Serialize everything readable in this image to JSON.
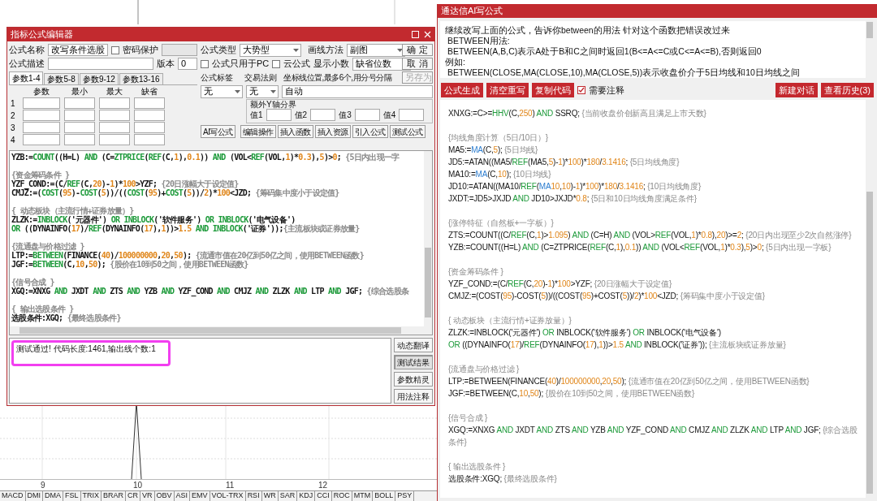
{
  "left_dialog": {
    "title": "指标公式编辑器",
    "name_field": {
      "label": "公式名称",
      "value": "改写条件选股"
    },
    "password": {
      "label": "密码保护",
      "checked": false
    },
    "desc_field": {
      "label": "公式描述"
    },
    "version": {
      "label": "版本",
      "value": "0"
    },
    "formula_type": {
      "label": "公式类型",
      "value": "大势型"
    },
    "draw_method": {
      "label": "画线方法",
      "value": "副图"
    },
    "pc_only": {
      "label": "公式只用于PC",
      "checked": false
    },
    "cloud": {
      "label": "云公式",
      "checked": false
    },
    "decimals": {
      "label": "显示小数",
      "value": "缺省位数"
    },
    "dialog_buttons": [
      {
        "label": "确 定",
        "disabled": false
      },
      {
        "label": "取 消",
        "disabled": false
      },
      {
        "label": "另存为",
        "disabled": true
      }
    ],
    "param_tabs": [
      {
        "label": "参数1-4",
        "selected": true
      },
      {
        "label": "参数5-8",
        "selected": false
      },
      {
        "label": "参数9-12",
        "selected": false
      },
      {
        "label": "参数13-16",
        "selected": false
      }
    ],
    "param_columns": [
      "参数",
      "最小",
      "最大",
      "缺省"
    ],
    "param_rows": [
      "1",
      "2",
      "3",
      "4"
    ],
    "tag": {
      "label": "公式标签",
      "value": "无"
    },
    "trade_rule": {
      "label": "交易法则",
      "value": "无"
    },
    "axis_lines": {
      "label": "坐标线位置,最多6个,用分号分隔",
      "value": "自动"
    },
    "y_bounds": {
      "title": "额外Y轴分界",
      "labels": [
        "值1",
        "值2",
        "值3",
        "值4"
      ]
    },
    "action_buttons": [
      "AI写公式",
      "编辑操作",
      "插入函数",
      "插入资源",
      "引入公式",
      "测试公式"
    ],
    "editor": {
      "blocks": [
        [
          [
            {
              "kind": "t",
              "text": "YZB:="
            },
            {
              "kind": "f",
              "text": "COUNT"
            },
            {
              "kind": "t",
              "text": "((H=L) "
            },
            {
              "kind": "k",
              "text": "AND"
            },
            {
              "kind": "t",
              "text": " (C="
            },
            {
              "kind": "f",
              "text": "ZTPRICE"
            },
            {
              "kind": "t",
              "text": "("
            },
            {
              "kind": "f",
              "text": "REF"
            },
            {
              "kind": "t",
              "text": "(C,"
            },
            {
              "kind": "n",
              "text": "1"
            },
            {
              "kind": "t",
              "text": "),"
            },
            {
              "kind": "n",
              "text": "0.1"
            },
            {
              "kind": "t",
              "text": ")) "
            },
            {
              "kind": "k",
              "text": "AND"
            },
            {
              "kind": "t",
              "text": " (VOL<"
            },
            {
              "kind": "f",
              "text": "REF"
            },
            {
              "kind": "t",
              "text": "(VOL,"
            },
            {
              "kind": "n",
              "text": "1"
            },
            {
              "kind": "t",
              "text": ")*"
            },
            {
              "kind": "n",
              "text": "0.3"
            },
            {
              "kind": "t",
              "text": "),"
            },
            {
              "kind": "n",
              "text": "5"
            },
            {
              "kind": "t",
              "text": ")>"
            },
            {
              "kind": "n",
              "text": "0"
            },
            {
              "kind": "t",
              "text": "; "
            },
            {
              "kind": "c",
              "text": "{5日内出现一字"
            }
          ]
        ],
        [
          [
            {
              "kind": "c",
              "text": "{资金筹码条件 }"
            }
          ],
          [
            {
              "kind": "t",
              "text": "YZF_COND:=(C/"
            },
            {
              "kind": "f",
              "text": "REF"
            },
            {
              "kind": "t",
              "text": "(C,"
            },
            {
              "kind": "n",
              "text": "20"
            },
            {
              "kind": "t",
              "text": ")-"
            },
            {
              "kind": "n",
              "text": "1"
            },
            {
              "kind": "t",
              "text": ")*"
            },
            {
              "kind": "n",
              "text": "100"
            },
            {
              "kind": "t",
              "text": ">YZF; "
            },
            {
              "kind": "c",
              "text": "{20日涨幅大于设定值}"
            }
          ],
          [
            {
              "kind": "t",
              "text": "CMJZ:=("
            },
            {
              "kind": "f",
              "text": "COST"
            },
            {
              "kind": "t",
              "text": "("
            },
            {
              "kind": "n",
              "text": "95"
            },
            {
              "kind": "t",
              "text": ")-"
            },
            {
              "kind": "f",
              "text": "COST"
            },
            {
              "kind": "t",
              "text": "("
            },
            {
              "kind": "n",
              "text": "5"
            },
            {
              "kind": "t",
              "text": "))/(("
            },
            {
              "kind": "f",
              "text": "COST"
            },
            {
              "kind": "t",
              "text": "("
            },
            {
              "kind": "n",
              "text": "95"
            },
            {
              "kind": "t",
              "text": ")+"
            },
            {
              "kind": "f",
              "text": "COST"
            },
            {
              "kind": "t",
              "text": "("
            },
            {
              "kind": "n",
              "text": "5"
            },
            {
              "kind": "t",
              "text": "))/"
            },
            {
              "kind": "n",
              "text": "2"
            },
            {
              "kind": "t",
              "text": ")*"
            },
            {
              "kind": "n",
              "text": "100"
            },
            {
              "kind": "t",
              "text": "<JZD; "
            },
            {
              "kind": "c",
              "text": "{筹码集中度小于设定值}"
            }
          ]
        ],
        [
          [
            {
              "kind": "c",
              "text": "{ 动态板块（主流行情+证券放量）}"
            }
          ],
          [
            {
              "kind": "t",
              "text": "ZLZK:="
            },
            {
              "kind": "f",
              "text": "INBLOCK"
            },
            {
              "kind": "t",
              "text": "('元器件') "
            },
            {
              "kind": "k",
              "text": "OR "
            },
            {
              "kind": "f",
              "text": "INBLOCK"
            },
            {
              "kind": "t",
              "text": "('软件服务') "
            },
            {
              "kind": "k",
              "text": "OR "
            },
            {
              "kind": "f",
              "text": "INBLOCK"
            },
            {
              "kind": "t",
              "text": "('电气设备')"
            }
          ],
          [
            {
              "kind": "k",
              "text": "OR"
            },
            {
              "kind": "t",
              "text": " ((DYNAINFO("
            },
            {
              "kind": "n",
              "text": "17"
            },
            {
              "kind": "t",
              "text": ")/"
            },
            {
              "kind": "f",
              "text": "REF"
            },
            {
              "kind": "t",
              "text": "(DYNAINFO("
            },
            {
              "kind": "n",
              "text": "17"
            },
            {
              "kind": "t",
              "text": "),"
            },
            {
              "kind": "n",
              "text": "1"
            },
            {
              "kind": "t",
              "text": "))>"
            },
            {
              "kind": "n",
              "text": "1.5"
            },
            {
              "kind": "k",
              "text": " AND "
            },
            {
              "kind": "f",
              "text": "INBLOCK"
            },
            {
              "kind": "t",
              "text": "('证券'));"
            },
            {
              "kind": "c",
              "text": "{主流板块或证券放量}"
            }
          ]
        ],
        [
          [
            {
              "kind": "c",
              "text": "{流通盘与价格过滤 }"
            }
          ],
          [
            {
              "kind": "t",
              "text": "LTP:="
            },
            {
              "kind": "f",
              "text": "BETWEEN"
            },
            {
              "kind": "t",
              "text": "(FINANCE("
            },
            {
              "kind": "n",
              "text": "40"
            },
            {
              "kind": "t",
              "text": ")/"
            },
            {
              "kind": "n",
              "text": "100000000"
            },
            {
              "kind": "t",
              "text": ","
            },
            {
              "kind": "n",
              "text": "20"
            },
            {
              "kind": "t",
              "text": ","
            },
            {
              "kind": "n",
              "text": "50"
            },
            {
              "kind": "t",
              "text": "); "
            },
            {
              "kind": "c",
              "text": "{流通市值在20亿到50亿之间，使用BETWEEN函数}"
            }
          ],
          [
            {
              "kind": "t",
              "text": "JGF:="
            },
            {
              "kind": "f",
              "text": "BETWEEN"
            },
            {
              "kind": "t",
              "text": "(C,"
            },
            {
              "kind": "n",
              "text": "10"
            },
            {
              "kind": "t",
              "text": ","
            },
            {
              "kind": "n",
              "text": "50"
            },
            {
              "kind": "t",
              "text": "); "
            },
            {
              "kind": "c",
              "text": "{股价在10到50之间，使用BETWEEN函数}"
            }
          ]
        ],
        [
          [
            {
              "kind": "c",
              "text": "{信号合成 }"
            }
          ],
          [
            {
              "kind": "t",
              "text": "XGQ:=XNXG "
            },
            {
              "kind": "k",
              "text": "AND"
            },
            {
              "kind": "t",
              "text": " JXDT "
            },
            {
              "kind": "k",
              "text": "AND"
            },
            {
              "kind": "t",
              "text": " ZTS "
            },
            {
              "kind": "k",
              "text": "AND"
            },
            {
              "kind": "t",
              "text": " YZB "
            },
            {
              "kind": "k",
              "text": "AND"
            },
            {
              "kind": "t",
              "text": " YZF_COND "
            },
            {
              "kind": "k",
              "text": "AND"
            },
            {
              "kind": "t",
              "text": " CMJZ "
            },
            {
              "kind": "k",
              "text": "AND"
            },
            {
              "kind": "t",
              "text": " ZLZK "
            },
            {
              "kind": "k",
              "text": "AND"
            },
            {
              "kind": "t",
              "text": " LTP "
            },
            {
              "kind": "k",
              "text": "AND"
            },
            {
              "kind": "t",
              "text": " JGF; "
            },
            {
              "kind": "c",
              "text": "{综合选股条"
            }
          ]
        ],
        [
          [
            {
              "kind": "c",
              "text": "{ 输出选股条件 }"
            }
          ],
          [
            {
              "kind": "t",
              "text": "选股条件:XGQ; "
            },
            {
              "kind": "c",
              "text": "{最终选股条件}"
            }
          ]
        ]
      ]
    },
    "test_result": "测试通过! 代码长度:1461,输出线个数:1",
    "side_buttons": [
      {
        "label": "动态翻译",
        "selected": false
      },
      {
        "label": "测试结果",
        "selected": true
      },
      {
        "label": "参数精灵",
        "selected": false
      },
      {
        "label": "用法注释",
        "selected": false
      }
    ]
  },
  "right_window": {
    "title": "通达信AI写公式",
    "prompt_lines": [
      "继续改写上面的公式，告诉你between的用法 针对这个函数把错误改过来",
      " BETWEEN用法:",
      " BETWEEN(A,B,C)表示A处于B和C之间时返回1(B<=A<=C或C<=A<=B),否则返回0",
      "例如:",
      " BETWEEN(CLOSE,MA(CLOSE,10),MA(CLOSE,5))表示收盘价介于5日均线和10日均线之间"
    ],
    "left_buttons": [
      "公式生成",
      "清空重写",
      "复制代码"
    ],
    "annotate": {
      "label": "需要注释",
      "checked": true
    },
    "right_buttons": [
      "新建对话",
      "查看历史(3)"
    ],
    "code": {
      "blocks": [
        [
          [
            {
              "kind": "t",
              "text": "XNXG:=C>="
            },
            {
              "kind": "f",
              "text": "HHV"
            },
            {
              "kind": "t",
              "text": "(C,"
            },
            {
              "kind": "n",
              "text": "250"
            },
            {
              "kind": "t",
              "text": ") "
            },
            {
              "kind": "k",
              "text": "AND"
            },
            {
              "kind": "t",
              "text": " SSRQ; "
            },
            {
              "kind": "c",
              "text": "{当前收盘价创新高且满足上市天数}"
            }
          ]
        ],
        [
          [
            {
              "kind": "c",
              "text": "{均线角度计算（5日/10日）}"
            }
          ],
          [
            {
              "kind": "t",
              "text": "MA5:="
            },
            {
              "kind": "b",
              "text": "MA"
            },
            {
              "kind": "t",
              "text": "(C,"
            },
            {
              "kind": "n",
              "text": "5"
            },
            {
              "kind": "t",
              "text": "); "
            },
            {
              "kind": "c",
              "text": "{5日均线}"
            }
          ],
          [
            {
              "kind": "t",
              "text": "JD5:=ATAN((MA5/"
            },
            {
              "kind": "f",
              "text": "REF"
            },
            {
              "kind": "t",
              "text": "(MA5,"
            },
            {
              "kind": "n",
              "text": "5"
            },
            {
              "kind": "t",
              "text": ")-"
            },
            {
              "kind": "n",
              "text": "1"
            },
            {
              "kind": "t",
              "text": ")*"
            },
            {
              "kind": "n",
              "text": "100"
            },
            {
              "kind": "t",
              "text": ")*"
            },
            {
              "kind": "n",
              "text": "180"
            },
            {
              "kind": "t",
              "text": "/"
            },
            {
              "kind": "n",
              "text": "3.1416"
            },
            {
              "kind": "t",
              "text": "; "
            },
            {
              "kind": "c",
              "text": "{5日均线角度}"
            }
          ],
          [
            {
              "kind": "t",
              "text": "MA10:="
            },
            {
              "kind": "b",
              "text": "MA"
            },
            {
              "kind": "t",
              "text": "(C,"
            },
            {
              "kind": "n",
              "text": "10"
            },
            {
              "kind": "t",
              "text": "); "
            },
            {
              "kind": "c",
              "text": "{10日均线}"
            }
          ],
          [
            {
              "kind": "t",
              "text": "JD10:=ATAN((MA10/"
            },
            {
              "kind": "f",
              "text": "REF"
            },
            {
              "kind": "t",
              "text": "("
            },
            {
              "kind": "b",
              "text": "MA"
            },
            {
              "kind": "n",
              "text": "10"
            },
            {
              "kind": "t",
              "text": ","
            },
            {
              "kind": "n",
              "text": "10"
            },
            {
              "kind": "t",
              "text": ")-"
            },
            {
              "kind": "n",
              "text": "1"
            },
            {
              "kind": "t",
              "text": ")*"
            },
            {
              "kind": "n",
              "text": "100"
            },
            {
              "kind": "t",
              "text": ")*"
            },
            {
              "kind": "n",
              "text": "180"
            },
            {
              "kind": "t",
              "text": "/"
            },
            {
              "kind": "n",
              "text": "3.1416"
            },
            {
              "kind": "t",
              "text": "; "
            },
            {
              "kind": "c",
              "text": "{10日均线角度}"
            }
          ],
          [
            {
              "kind": "t",
              "text": "JXDT:=JD5>JXJD "
            },
            {
              "kind": "k",
              "text": "AND"
            },
            {
              "kind": "t",
              "text": " JD10>JXJD*"
            },
            {
              "kind": "n",
              "text": "0.8"
            },
            {
              "kind": "t",
              "text": "; "
            },
            {
              "kind": "c",
              "text": "{5日和10日均线角度满足条件}"
            }
          ]
        ],
        [
          [
            {
              "kind": "c",
              "text": "{涨停特征（自然板+一字板）}"
            }
          ],
          [
            {
              "kind": "t",
              "text": "ZTS:=COUNT((C/"
            },
            {
              "kind": "f",
              "text": "REF"
            },
            {
              "kind": "t",
              "text": "(C,"
            },
            {
              "kind": "n",
              "text": "1"
            },
            {
              "kind": "t",
              "text": ")>"
            },
            {
              "kind": "n",
              "text": "1.095"
            },
            {
              "kind": "t",
              "text": ") "
            },
            {
              "kind": "k",
              "text": "AND"
            },
            {
              "kind": "t",
              "text": " (C=H) "
            },
            {
              "kind": "k",
              "text": "AND"
            },
            {
              "kind": "t",
              "text": " (VOL>"
            },
            {
              "kind": "f",
              "text": "REF"
            },
            {
              "kind": "t",
              "text": "(VOL,"
            },
            {
              "kind": "n",
              "text": "1"
            },
            {
              "kind": "t",
              "text": ")*"
            },
            {
              "kind": "n",
              "text": "0.8"
            },
            {
              "kind": "t",
              "text": "),"
            },
            {
              "kind": "n",
              "text": "20"
            },
            {
              "kind": "t",
              "text": ")>="
            },
            {
              "kind": "n",
              "text": "2"
            },
            {
              "kind": "t",
              "text": "; "
            },
            {
              "kind": "c",
              "text": "{20日内出现至少2次自然涨停}"
            }
          ],
          [
            {
              "kind": "t",
              "text": "YZB:=COUNT((H=L) "
            },
            {
              "kind": "k",
              "text": "AND"
            },
            {
              "kind": "t",
              "text": " (C=ZTPRICE("
            },
            {
              "kind": "f",
              "text": "REF"
            },
            {
              "kind": "t",
              "text": "(C,"
            },
            {
              "kind": "n",
              "text": "1"
            },
            {
              "kind": "t",
              "text": "),"
            },
            {
              "kind": "n",
              "text": "0.1"
            },
            {
              "kind": "t",
              "text": ")) "
            },
            {
              "kind": "k",
              "text": "AND"
            },
            {
              "kind": "t",
              "text": " (VOL<"
            },
            {
              "kind": "f",
              "text": "REF"
            },
            {
              "kind": "t",
              "text": "(VOL,"
            },
            {
              "kind": "n",
              "text": "1"
            },
            {
              "kind": "t",
              "text": ")*"
            },
            {
              "kind": "n",
              "text": "0.3"
            },
            {
              "kind": "t",
              "text": "),"
            },
            {
              "kind": "n",
              "text": "5"
            },
            {
              "kind": "t",
              "text": ")>"
            },
            {
              "kind": "n",
              "text": "0"
            },
            {
              "kind": "t",
              "text": "; "
            },
            {
              "kind": "c",
              "text": "{5日内出现一字板}"
            }
          ]
        ],
        [
          [
            {
              "kind": "c",
              "text": "{资金筹码条件 }"
            }
          ],
          [
            {
              "kind": "t",
              "text": "YZF_COND:=(C/"
            },
            {
              "kind": "f",
              "text": "REF"
            },
            {
              "kind": "t",
              "text": "(C,"
            },
            {
              "kind": "n",
              "text": "20"
            },
            {
              "kind": "t",
              "text": ")-"
            },
            {
              "kind": "n",
              "text": "1"
            },
            {
              "kind": "t",
              "text": ")*"
            },
            {
              "kind": "n",
              "text": "100"
            },
            {
              "kind": "t",
              "text": ">YZF; "
            },
            {
              "kind": "c",
              "text": "{20日涨幅大于设定值}"
            }
          ],
          [
            {
              "kind": "t",
              "text": "CMJZ:=(COST("
            },
            {
              "kind": "n",
              "text": "95"
            },
            {
              "kind": "t",
              "text": ")-COST("
            },
            {
              "kind": "n",
              "text": "5"
            },
            {
              "kind": "t",
              "text": "))/((COST("
            },
            {
              "kind": "n",
              "text": "95"
            },
            {
              "kind": "t",
              "text": ")+COST("
            },
            {
              "kind": "n",
              "text": "5"
            },
            {
              "kind": "t",
              "text": "))/"
            },
            {
              "kind": "n",
              "text": "2"
            },
            {
              "kind": "t",
              "text": ")*"
            },
            {
              "kind": "n",
              "text": "100"
            },
            {
              "kind": "t",
              "text": "<JZD; "
            },
            {
              "kind": "c",
              "text": "{筹码集中度小于设定值}"
            }
          ]
        ],
        [
          [
            {
              "kind": "c",
              "text": "{ 动态板块（主流行情+证券放量）}"
            }
          ],
          [
            {
              "kind": "t",
              "text": "ZLZK:=INBLOCK('元器件') "
            },
            {
              "kind": "k",
              "text": "OR"
            },
            {
              "kind": "t",
              "text": " INBLOCK('软件服务') "
            },
            {
              "kind": "k",
              "text": "OR"
            },
            {
              "kind": "t",
              "text": " INBLOCK('电气设备')"
            }
          ],
          [
            {
              "kind": "k",
              "text": "OR"
            },
            {
              "kind": "t",
              "text": " ((DYNAINFO("
            },
            {
              "kind": "n",
              "text": "17"
            },
            {
              "kind": "t",
              "text": ")/"
            },
            {
              "kind": "f",
              "text": "REF"
            },
            {
              "kind": "t",
              "text": "(DYNAINFO("
            },
            {
              "kind": "n",
              "text": "17"
            },
            {
              "kind": "t",
              "text": "),"
            },
            {
              "kind": "n",
              "text": "1"
            },
            {
              "kind": "t",
              "text": "))>"
            },
            {
              "kind": "n",
              "text": "1.5"
            },
            {
              "kind": "k",
              "text": " AND"
            },
            {
              "kind": "t",
              "text": " INBLOCK('证券')); "
            },
            {
              "kind": "c",
              "text": "{主流板块或证券放量}"
            }
          ]
        ],
        [
          [
            {
              "kind": "c",
              "text": "{流通盘与价格过滤 }"
            }
          ],
          [
            {
              "kind": "t",
              "text": "LTP:=BETWEEN(FINANCE("
            },
            {
              "kind": "n",
              "text": "40"
            },
            {
              "kind": "t",
              "text": ")/"
            },
            {
              "kind": "n",
              "text": "100000000"
            },
            {
              "kind": "t",
              "text": ","
            },
            {
              "kind": "n",
              "text": "20"
            },
            {
              "kind": "t",
              "text": ","
            },
            {
              "kind": "n",
              "text": "50"
            },
            {
              "kind": "t",
              "text": "); "
            },
            {
              "kind": "c",
              "text": "{流通市值在20亿到50亿之间，使用BETWEEN函数}"
            }
          ],
          [
            {
              "kind": "t",
              "text": "JGF:=BETWEEN(C,"
            },
            {
              "kind": "n",
              "text": "10"
            },
            {
              "kind": "t",
              "text": ","
            },
            {
              "kind": "n",
              "text": "50"
            },
            {
              "kind": "t",
              "text": "); "
            },
            {
              "kind": "c",
              "text": "{股价在10到50之间，使用BETWEEN函数}"
            }
          ]
        ],
        [
          [
            {
              "kind": "c",
              "text": "{信号合成 }"
            }
          ],
          [
            {
              "kind": "t",
              "text": "XGQ:=XNXG "
            },
            {
              "kind": "k",
              "text": "AND"
            },
            {
              "kind": "t",
              "text": " JXDT "
            },
            {
              "kind": "k",
              "text": "AND"
            },
            {
              "kind": "t",
              "text": " ZTS "
            },
            {
              "kind": "k",
              "text": "AND"
            },
            {
              "kind": "t",
              "text": " YZB "
            },
            {
              "kind": "k",
              "text": "AND"
            },
            {
              "kind": "t",
              "text": " YZF_COND "
            },
            {
              "kind": "k",
              "text": "AND"
            },
            {
              "kind": "t",
              "text": " CMJZ "
            },
            {
              "kind": "k",
              "text": "AND"
            },
            {
              "kind": "t",
              "text": " ZLZK "
            },
            {
              "kind": "k",
              "text": "AND"
            },
            {
              "kind": "t",
              "text": " LTP "
            },
            {
              "kind": "k",
              "text": "AND"
            },
            {
              "kind": "t",
              "text": " JGF; "
            },
            {
              "kind": "c",
              "text": "{综合选股条件}"
            }
          ]
        ],
        [
          [
            {
              "kind": "c",
              "text": "{ 输出选股条件 }"
            }
          ],
          [
            {
              "kind": "t",
              "text": "选股条件:XGQ; "
            },
            {
              "kind": "c",
              "text": "{最终选股条件}"
            }
          ]
        ]
      ]
    }
  },
  "chart": {
    "x_labels": [
      "9",
      "10",
      "11",
      "12"
    ],
    "indicator_tabs": [
      "MACD",
      "DMI",
      "DMA",
      "FSL",
      "TRIX",
      "BRAR",
      "CR",
      "VR",
      "OBV",
      "ASI",
      "EMV",
      "VOL-TRX",
      "RSI",
      "WR",
      "SAR",
      "KDJ",
      "CCI",
      "ROC",
      "MTM",
      "BOLL",
      "PSY"
    ]
  }
}
